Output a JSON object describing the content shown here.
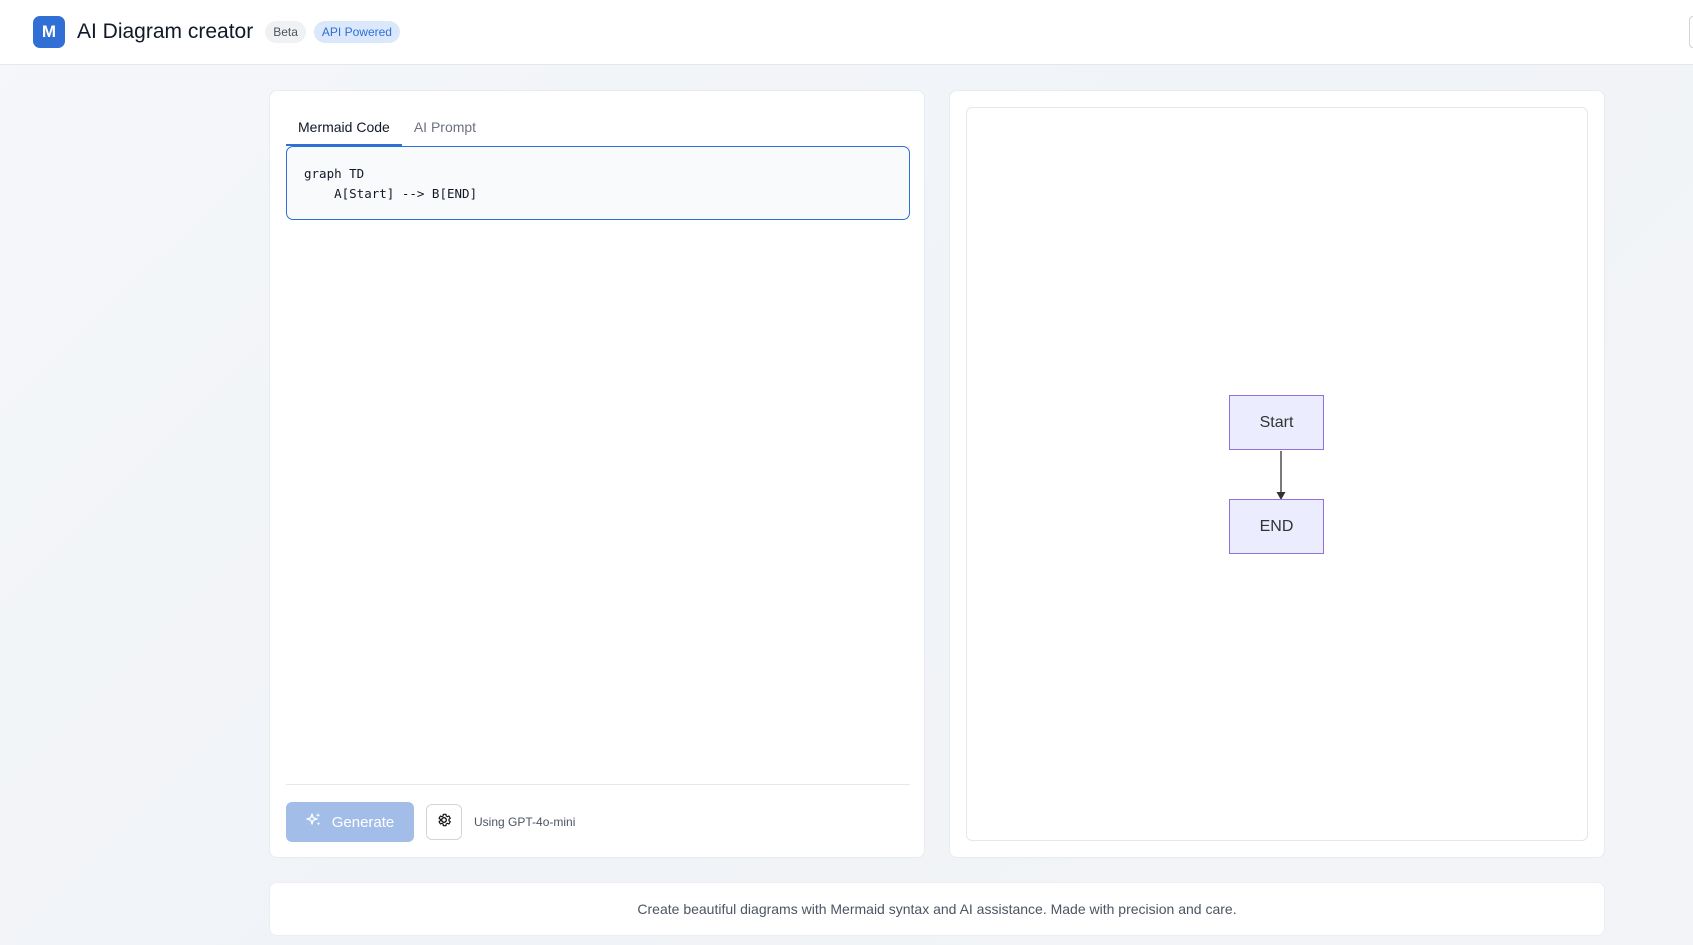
{
  "header": {
    "logo_letter": "M",
    "title": "AI Diagram creator",
    "badges": [
      "Beta",
      "API Powered"
    ]
  },
  "editor": {
    "tabs": [
      {
        "label": "Mermaid Code",
        "active": true
      },
      {
        "label": "AI Prompt",
        "active": false
      }
    ],
    "code": "graph TD\n    A[Start] --> B[END]",
    "generate_label": "Generate",
    "model_label": "Using GPT-4o-mini"
  },
  "diagram": {
    "nodes": [
      {
        "id": "A",
        "label": "Start"
      },
      {
        "id": "B",
        "label": "END"
      }
    ]
  },
  "footer": {
    "text": "Create beautiful diagrams with Mermaid syntax and AI assistance. Made with precision and care."
  },
  "colors": {
    "accent": "#2f6fd6",
    "node_fill": "#ececff",
    "node_border": "#9370db"
  }
}
